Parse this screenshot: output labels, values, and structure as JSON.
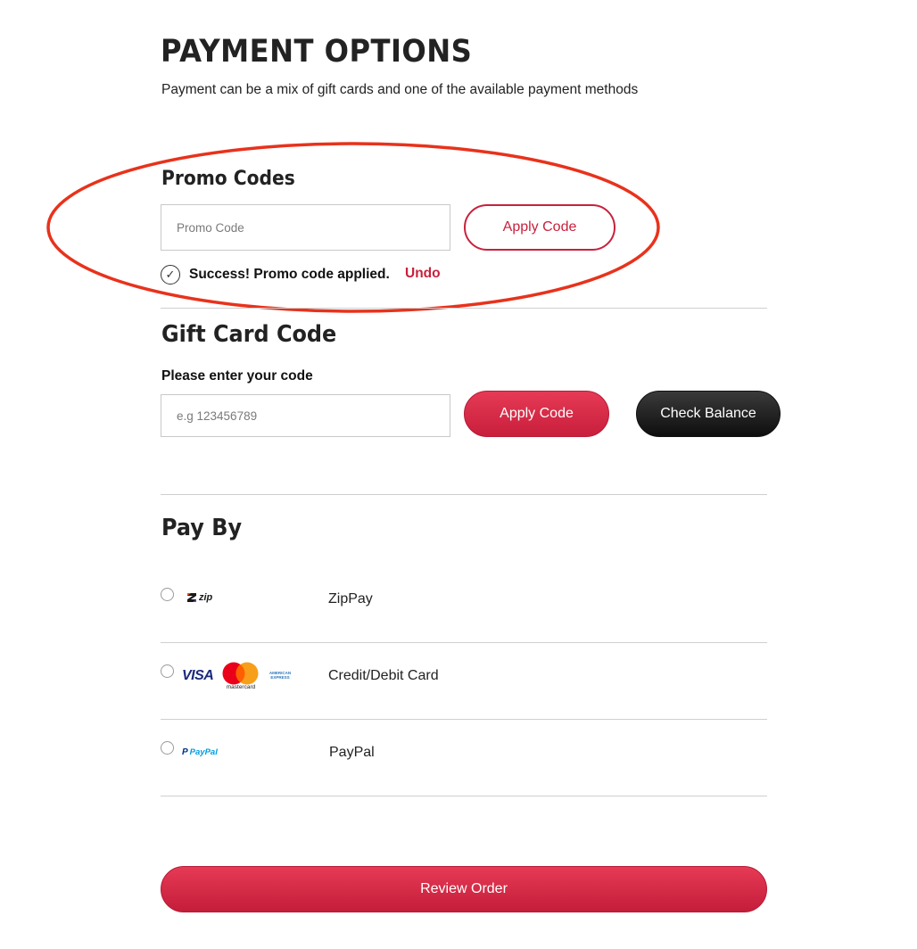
{
  "page": {
    "title": "PAYMENT OPTIONS",
    "subtitle": "Payment can be a mix of gift cards and one of the available payment methods"
  },
  "promo": {
    "title": "Promo Codes",
    "input_placeholder": "Promo Code",
    "apply_label": "Apply Code",
    "success_text": "Success! Promo code applied.",
    "undo_label": "Undo"
  },
  "gift_card": {
    "title": "Gift Card Code",
    "field_label": "Please enter your code",
    "input_placeholder": "e.g 123456789",
    "apply_label": "Apply Code",
    "check_balance_label": "Check Balance"
  },
  "pay_by": {
    "title": "Pay By",
    "methods": [
      {
        "name": "ZipPay",
        "logo_text": "zip",
        "icon": "zip-logo-icon"
      },
      {
        "name": "Credit/Debit Card",
        "logo_text": "VISA",
        "logo_text_2": "mastercard",
        "logo_text_3": "AMERICAN EXPRESS",
        "icon": "card-logos-icon"
      },
      {
        "name": "PayPal",
        "logo_text": "PayPal",
        "icon": "paypal-logo-icon"
      }
    ]
  },
  "footer": {
    "review_label": "Review Order"
  },
  "colors": {
    "accent": "#c8213d",
    "annotation": "#e8321c",
    "dark_button": "#1a1a1a"
  }
}
